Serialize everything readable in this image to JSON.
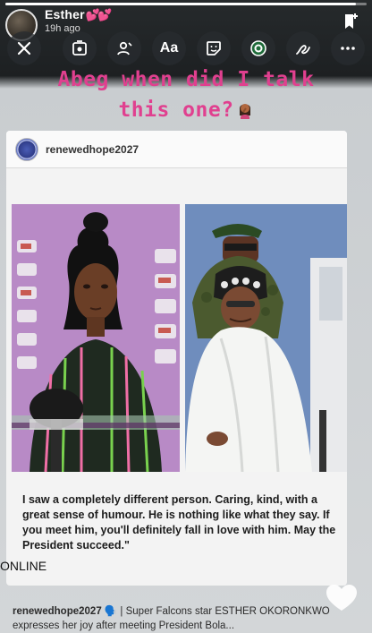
{
  "story": {
    "username": "Esther",
    "username_hearts": "💕💕",
    "time_ago": "19h ago",
    "progress": 0.97
  },
  "toolbar": {
    "text_tool_label": "Aa",
    "icons": [
      "close-icon",
      "media-icon",
      "mention-icon",
      "text-icon",
      "sticker-icon",
      "badge-icon",
      "draw-icon",
      "more-icon"
    ]
  },
  "caption": {
    "line1": "Abeg when did I talk",
    "line2": "this one?"
  },
  "post": {
    "username": "renewedhope2027",
    "quote": "I saw a completely different person. Caring, kind, with a great sense of humour. He is nothing like what they say. If you meet him, you'll definitely fall in love with him. May the President succeed.\""
  },
  "overlay_text": "ONLINE",
  "footer": {
    "username": "renewedhope2027",
    "text": "🗣️ | Super Falcons star ESTHER OKORONKWO expresses her joy after meeting President Bola..."
  },
  "colors": {
    "caption": "#e0408f",
    "hearts": "#ff5cc8"
  }
}
